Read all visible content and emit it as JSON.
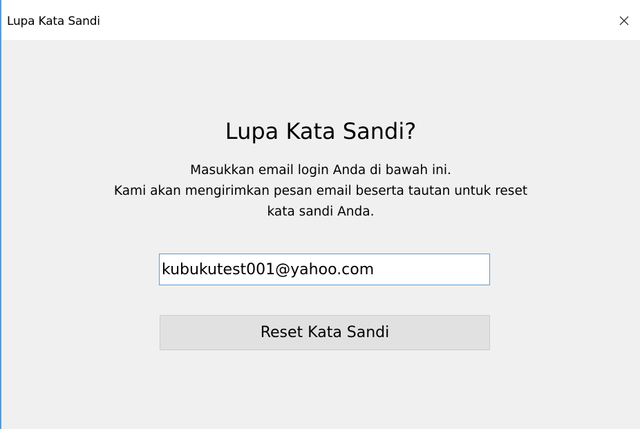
{
  "window": {
    "title": "Lupa Kata Sandi",
    "close_icon": "close-icon"
  },
  "dialog": {
    "heading": "Lupa Kata Sandi?",
    "description_lines": [
      "Masukkan email login Anda di bawah ini.",
      "Kami akan mengirimkan pesan email beserta tautan untuk reset",
      "kata sandi Anda."
    ],
    "email_value": "kubukutest001@yahoo.com",
    "reset_button_label": "Reset Kata Sandi"
  },
  "colors": {
    "window_border": "#5b9bd5",
    "background": "#f0f0f0",
    "input_border": "#5b9bd5",
    "button_bg": "#e1e1e1"
  }
}
